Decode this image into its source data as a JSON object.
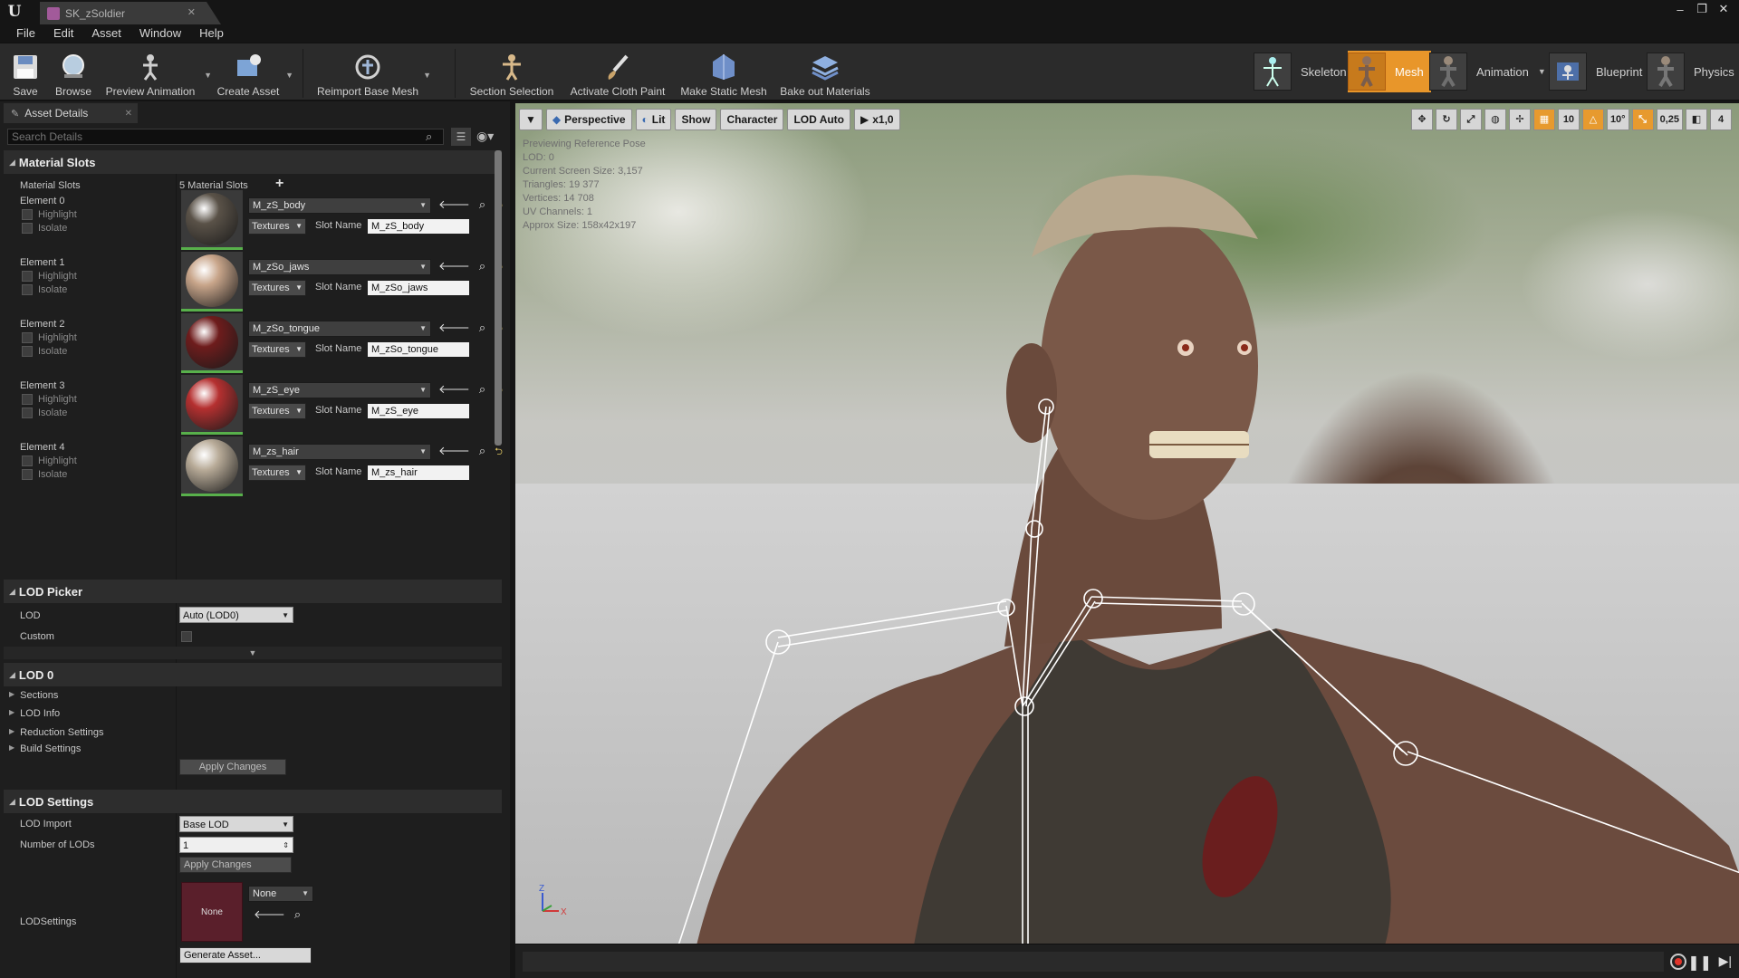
{
  "document_tab": {
    "title": "SK_zSoldier"
  },
  "menu": [
    "File",
    "Edit",
    "Asset",
    "Window",
    "Help"
  ],
  "toolbar": {
    "save": "Save",
    "browse": "Browse",
    "preview_animation": "Preview Animation",
    "create_asset": "Create Asset",
    "reimport": "Reimport Base Mesh",
    "section_selection": "Section Selection",
    "activate_cloth": "Activate Cloth Paint",
    "make_static": "Make Static Mesh",
    "bake_materials": "Bake out Materials"
  },
  "modes": {
    "skeleton": "Skeleton",
    "mesh": "Mesh",
    "animation": "Animation",
    "blueprint": "Blueprint",
    "physics": "Physics",
    "active": "Mesh",
    "active_color": "#e8962a"
  },
  "details_panel": {
    "tab_label": "Asset Details",
    "search_placeholder": "Search Details",
    "material_slots": {
      "title": "Material Slots",
      "row_label": "Material Slots",
      "count_label": "5 Material Slots",
      "highlight_label": "Highlight",
      "isolate_label": "Isolate",
      "textures_label": "Textures",
      "slot_name_label": "Slot Name",
      "elements": [
        {
          "label": "Element 0",
          "material": "M_zS_body",
          "slot_name": "M_zS_body",
          "ball_color": "#5a5248"
        },
        {
          "label": "Element 1",
          "material": "M_zSo_jaws",
          "slot_name": "M_zSo_jaws",
          "ball_color": "#c8a58a"
        },
        {
          "label": "Element 2",
          "material": "M_zSo_tongue",
          "slot_name": "M_zSo_tongue",
          "ball_color": "#6e1c1c"
        },
        {
          "label": "Element 3",
          "material": "M_zS_eye",
          "slot_name": "M_zS_eye",
          "ball_color": "#b53030"
        },
        {
          "label": "Element 4",
          "material": "M_zs_hair",
          "slot_name": "M_zs_hair",
          "ball_color": "#b8ab98"
        }
      ]
    },
    "lod_picker": {
      "title": "LOD Picker",
      "lod_label": "LOD",
      "lod_value": "Auto (LOD0)",
      "custom_label": "Custom"
    },
    "lod0": {
      "title": "LOD 0",
      "items": [
        "Sections",
        "LOD Info",
        "Reduction Settings",
        "Build Settings"
      ],
      "apply_label": "Apply Changes"
    },
    "lod_settings": {
      "title": "LOD Settings",
      "lod_import_label": "LOD Import",
      "lod_import_value": "Base LOD",
      "num_lods_label": "Number of LODs",
      "num_lods_value": "1",
      "apply_label": "Apply Changes",
      "lodsettings_label": "LODSettings",
      "asset_thumb_label": "None",
      "asset_value": "None",
      "generate_label": "Generate Asset..."
    }
  },
  "viewport": {
    "buttons": {
      "perspective": "Perspective",
      "lit": "Lit",
      "show": "Show",
      "character": "Character",
      "lod": "LOD Auto",
      "speed": "x1,0"
    },
    "right_tools": {
      "grid_snap": "10",
      "rot_snap": "10°",
      "scale_snap": "0,25",
      "cam_speed": "4"
    },
    "stats": [
      "Previewing Reference Pose",
      "LOD: 0",
      "Current Screen Size: 3,157",
      "Triangles: 19 377",
      "Vertices: 14 708",
      "UV Channels: 1",
      "Approx Size: 158x42x197"
    ],
    "axis": {
      "z": "Z",
      "x": "X"
    }
  }
}
